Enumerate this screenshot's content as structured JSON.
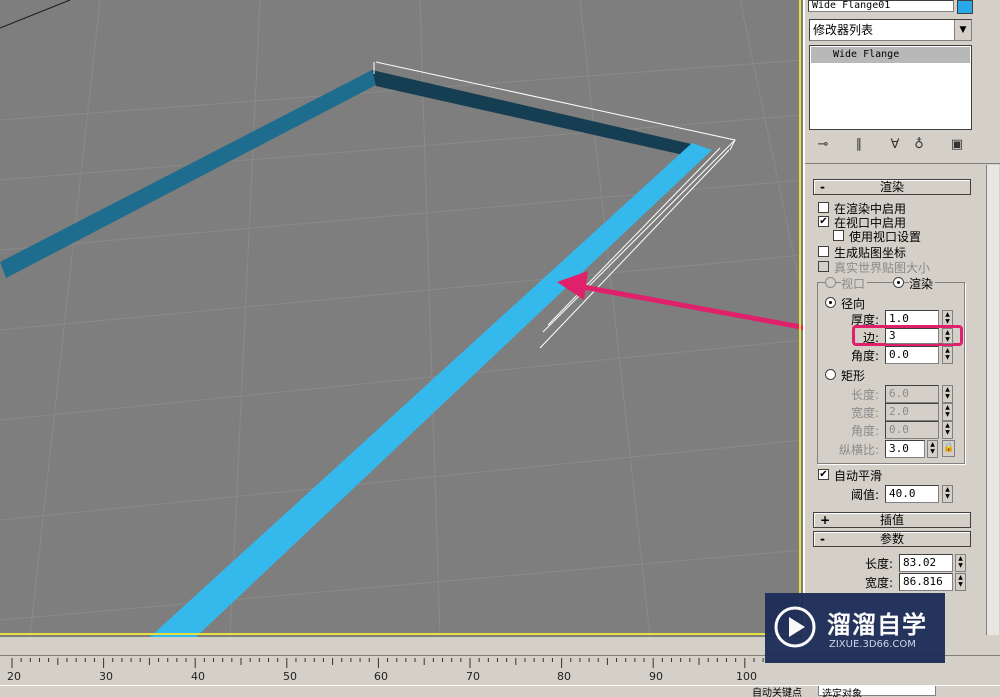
{
  "viewport": {
    "name": "perspective-viewport"
  },
  "panel": {
    "object_name": "Wide Flange01",
    "object_color": "#2aa8e8",
    "modifier_list": "修改器列表",
    "stack_item": "Wide Flange",
    "toolbar_icons": [
      "pin-stack-icon",
      "show-end-result-icon",
      "make-unique-icon",
      "remove-modifier-icon",
      "configure-modifier-sets-icon"
    ],
    "rendering_rollout": {
      "title": "渲染",
      "sign": "-",
      "enable_in_renderer": "在渲染中启用",
      "enable_in_viewport": "在视口中启用",
      "use_viewport_settings": "使用视口设置",
      "generate_mapping_coords": "生成贴图坐标",
      "real_world_map_size": "真实世界贴图大小",
      "viewport_option": "视口",
      "renderer_option": "渲染",
      "radial": "径向",
      "thickness_label": "厚度:",
      "thickness_value": "1.0",
      "sides_label": "边:",
      "sides_value": "3",
      "angle_label": "角度:",
      "angle_value": "0.0",
      "rectangular": "矩形",
      "length_label": "长度:",
      "length_value": "6.0",
      "width_label": "宽度:",
      "width_value": "2.0",
      "rect_angle_label": "角度:",
      "rect_angle_value": "0.0",
      "aspect_label": "纵横比:",
      "aspect_value": "3.0",
      "auto_smooth": "自动平滑",
      "threshold_label": "阈值:",
      "threshold_value": "40.0"
    },
    "interpolation_rollout": {
      "title": "插值",
      "sign": "+"
    },
    "parameters_rollout": {
      "title": "参数",
      "sign": "-",
      "length_label": "长度:",
      "length_value": "83.02",
      "width_label": "宽度:",
      "width_value": "86.816"
    }
  },
  "timeline": {
    "ticks": [
      "20",
      "30",
      "40",
      "50",
      "60",
      "70",
      "80",
      "90",
      "100"
    ]
  },
  "statusbar": {
    "auto_key": "自动关键点",
    "selected": "选定对象"
  },
  "watermark": {
    "title": "溜溜自学",
    "url": "ZIXUE.3D66.COM"
  },
  "colors": {
    "viewport_bg": "#7e7e7e",
    "selected_spline": "#35b8ec",
    "highlight": "#e0206a",
    "viewport_border": "#e8e040"
  }
}
